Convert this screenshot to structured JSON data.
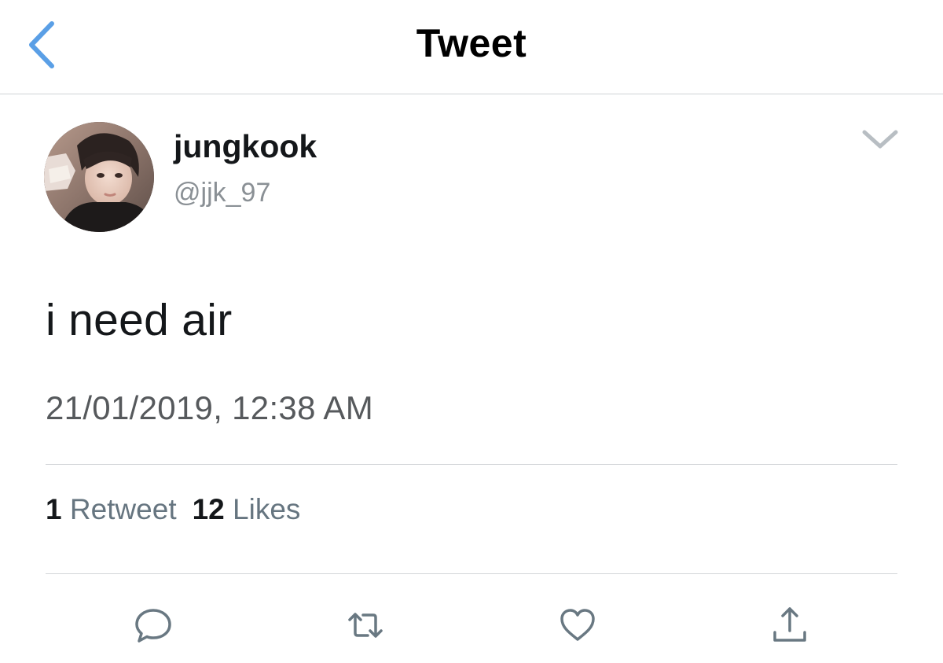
{
  "header": {
    "title": "Tweet",
    "back_icon": "chevron-left-icon",
    "accent_color": "#5a9fe6"
  },
  "tweet": {
    "author": {
      "display_name": "jungkook",
      "handle": "@jjk_97",
      "avatar": "profile-photo"
    },
    "text": "i need air",
    "timestamp": "21/01/2019, 12:38 AM",
    "stats": {
      "retweets_count": "1",
      "retweets_label": "Retweet",
      "likes_count": "12",
      "likes_label": "Likes"
    }
  },
  "actions": [
    {
      "icon": "reply-icon"
    },
    {
      "icon": "retweet-icon"
    },
    {
      "icon": "like-heart-icon"
    },
    {
      "icon": "share-icon"
    }
  ],
  "colors": {
    "text_primary": "#14171a",
    "text_secondary": "#667580",
    "icon_gray": "#697882",
    "divider": "#d3d6d9"
  }
}
